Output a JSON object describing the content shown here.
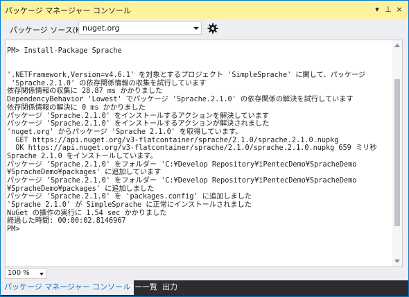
{
  "window": {
    "title": "パッケージ マネージャー コンソール",
    "controls": [
      "▾",
      "⊥",
      "×"
    ]
  },
  "toolbar": {
    "source_label": "パッケージ ソース(K):",
    "source_value": "nuget.org",
    "settings_icon": "gear-icon"
  },
  "console": {
    "lines": [
      "PM> Install-Package Sprache",
      "",
      "",
      "'.NETFramework,Version=v4.6.1' を対象とするプロジェクト 'SimpleSprache' に関して、パッケージ",
      " 'Sprache.2.1.0' の依存関係情報の収集を試行しています",
      "依存関係情報の収集に 28.87 ms かかりました",
      "DependencyBehavior 'Lowest' でパッケージ 'Sprache.2.1.0' の依存関係の解決を試行しています",
      "依存関係情報の解決に 0 ms かかりました",
      "パッケージ 'Sprache.2.1.0' をインストールするアクションを解決しています",
      "パッケージ 'Sprache.2.1.0' をインストールするアクションが解決されました",
      "'nuget.org' からパッケージ 'Sprache 2.1.0' を取得しています。",
      "  GET https://api.nuget.org/v3-flatcontainer/sprache/2.1.0/sprache.2.1.0.nupkg",
      "  OK https://api.nuget.org/v3-flatcontainer/sprache/2.1.0/sprache.2.1.0.nupkg 659 ミリ秒",
      "Sprache 2.1.0 をインストールしています。",
      "パッケージ 'Sprache.2.1.0' をフォルダー 'C:¥Develop Repository¥iPentecDemo¥SpracheDemo",
      "¥SpracheDemo¥packages' に追加しています",
      "パッケージ 'Sprache.2.1.0' をフォルダー 'C:¥Develop Repository¥iPentecDemo¥SpracheDemo",
      "¥SpracheDemo¥packages' に追加しました",
      "パッケージ 'Sprache.2.1.0' を 'packages.config' に追加しました",
      "'Sprache 2.1.0' が SimpleSprache に正常にインストールされました",
      "NuGet の操作の実行に 1.54 sec かかりました",
      "経過した時間: 00:00:02.8146967",
      "PM>"
    ]
  },
  "zoom": {
    "value": "100 %"
  },
  "tabs": [
    {
      "label": "パッケージ マネージャー コンソール",
      "active": true
    },
    {
      "label": "エラー一覧",
      "active": false
    },
    {
      "label": "出力",
      "active": false
    }
  ],
  "colors": {
    "accent": "#007acc",
    "title_bg": "#fff29d",
    "tab_bg": "#2d2d30",
    "active_tab_text": "#0e70c0"
  }
}
